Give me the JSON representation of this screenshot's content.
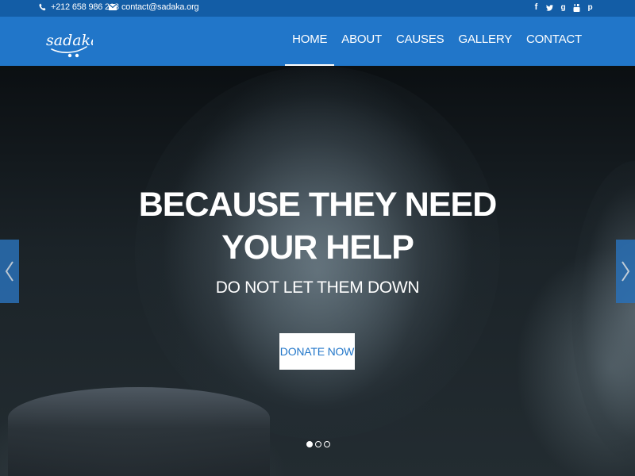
{
  "topbar": {
    "phone": "+212 658 986 213",
    "email": "contact@sadaka.org",
    "phone_icon": "phone-icon",
    "email_icon": "envelope-icon",
    "social": [
      "facebook-icon",
      "twitter-icon",
      "google-plus-icon",
      "youtube-icon",
      "pinterest-icon"
    ]
  },
  "navbar": {
    "logo": "sadaka",
    "items": [
      {
        "label": "HOME",
        "active": true
      },
      {
        "label": "ABOUT",
        "active": false
      },
      {
        "label": "CAUSES",
        "active": false
      },
      {
        "label": "GALLERY",
        "active": false
      },
      {
        "label": "CONTACT",
        "active": false
      }
    ]
  },
  "hero": {
    "title": "BECAUSE THEY NEED YOUR HELP",
    "subtitle": "DO NOT LET THEM DOWN",
    "cta": "DONATE NOW",
    "prev_icon": "chevron-left-icon",
    "next_icon": "chevron-right-icon",
    "slides_total": 3,
    "slide_active": 1
  },
  "colors": {
    "topbar": "#135da6",
    "navbar": "#2176c9",
    "cta_text": "#2176c9"
  }
}
